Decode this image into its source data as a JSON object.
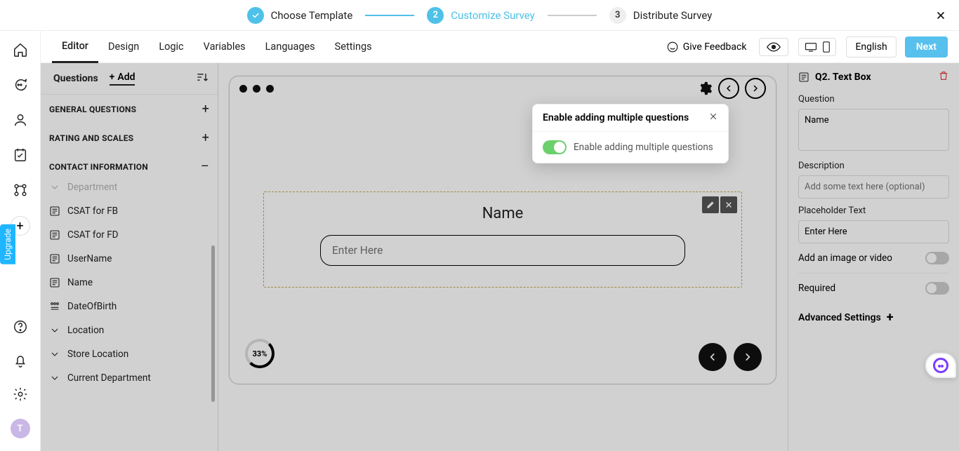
{
  "stepper": {
    "steps": [
      {
        "label": "Choose Template",
        "state": "done"
      },
      {
        "label": "Customize Survey",
        "state": "active"
      },
      {
        "label": "Distribute Survey",
        "state": "pending",
        "num": "3"
      }
    ]
  },
  "toolbar": {
    "tabs": [
      "Editor",
      "Design",
      "Logic",
      "Variables",
      "Languages",
      "Settings"
    ],
    "active_tab": "Editor",
    "feedback_label": "Give Feedback",
    "language": "English",
    "next_label": "Next"
  },
  "rail": {
    "avatar_initial": "T",
    "upgrade_label": "Upgrade"
  },
  "questions_panel": {
    "tab_questions": "Questions",
    "tab_add": "Add",
    "sections": {
      "general": "GENERAL QUESTIONS",
      "rating": "RATING AND SCALES",
      "contact": "CONTACT INFORMATION"
    },
    "contact_items": [
      {
        "label": "Department",
        "icon": "chevron"
      },
      {
        "label": "CSAT for FB",
        "icon": "text"
      },
      {
        "label": "CSAT for FD",
        "icon": "text"
      },
      {
        "label": "UserName",
        "icon": "text"
      },
      {
        "label": "Name",
        "icon": "text"
      },
      {
        "label": "DateOfBirth",
        "icon": "date"
      },
      {
        "label": "Location",
        "icon": "chevron"
      },
      {
        "label": "Store Location",
        "icon": "chevron"
      },
      {
        "label": "Current Department",
        "icon": "chevron"
      }
    ]
  },
  "preview": {
    "question_title": "Name",
    "input_placeholder": "Enter Here",
    "progress_label": "33%"
  },
  "popover": {
    "title": "Enable adding multiple questions",
    "body": "Enable adding multiple questions"
  },
  "props": {
    "header": "Q2. Text Box",
    "question_label": "Question",
    "question_value": "Name",
    "description_label": "Description",
    "description_placeholder": "Add some text here (optional)",
    "placeholder_label": "Placeholder Text",
    "placeholder_value": "Enter Here",
    "image_label": "Add an image or video",
    "required_label": "Required",
    "advanced_label": "Advanced Settings"
  }
}
